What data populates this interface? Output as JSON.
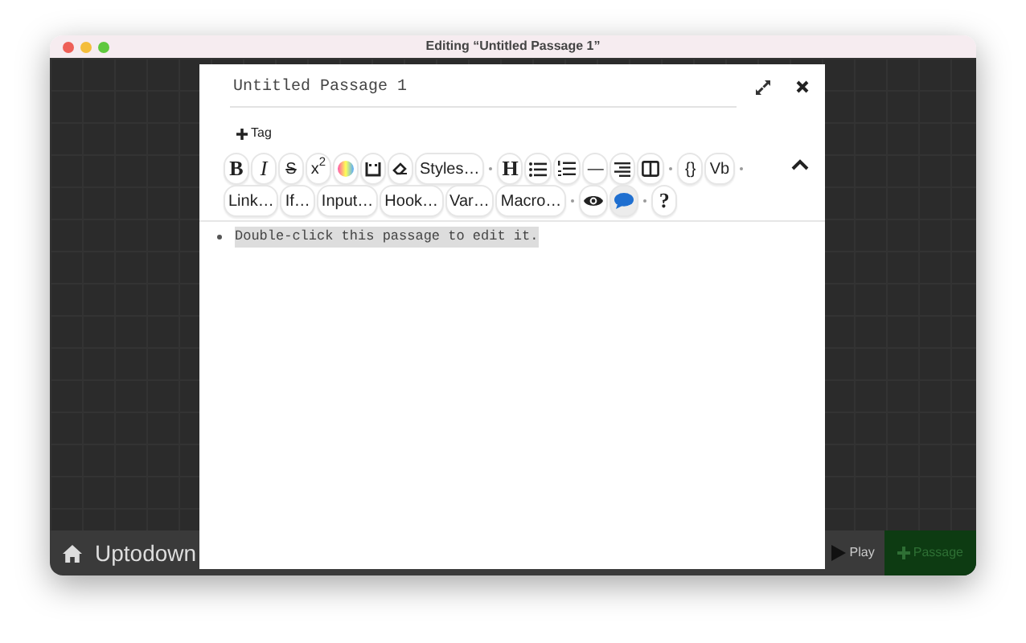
{
  "window": {
    "title": "Editing “Untitled Passage 1”"
  },
  "story_bar": {
    "story_name": "Uptodown",
    "play_label": "Play",
    "new_passage_label": "Passage"
  },
  "dialog": {
    "passage_name": "Untitled Passage 1",
    "tag_button": "Tag",
    "toolbar_rows": [
      [
        {
          "kind": "text",
          "label": "B"
        },
        {
          "kind": "text",
          "label": "I"
        },
        {
          "kind": "text",
          "label": "S"
        },
        {
          "kind": "text",
          "label": "x$^{2}$"
        },
        {
          "kind": "icon"
        },
        {
          "kind": "icon"
        },
        {
          "kind": "icon"
        },
        {
          "kind": "text",
          "label": "Styles…"
        },
        {
          "kind": "sep"
        },
        {
          "kind": "text",
          "label": "H"
        },
        {
          "kind": "icon"
        },
        {
          "kind": "icon"
        },
        {
          "kind": "text",
          "label": "—"
        },
        {
          "kind": "icon"
        },
        {
          "kind": "icon"
        },
        {
          "kind": "sep"
        },
        {
          "kind": "text",
          "label": "{}"
        },
        {
          "kind": "text",
          "label": "Vb"
        },
        {
          "kind": "sep"
        }
      ],
      [
        {
          "kind": "text",
          "label": "Link…"
        },
        {
          "kind": "text",
          "label": "If…"
        },
        {
          "kind": "text",
          "label": "Input…"
        },
        {
          "kind": "text",
          "label": "Hook…"
        },
        {
          "kind": "text",
          "label": "Var…"
        },
        {
          "kind": "text",
          "label": "Macro…"
        },
        {
          "kind": "sep"
        },
        {
          "kind": "icon",
          "selected": false
        },
        {
          "kind": "icon",
          "selected": true
        },
        {
          "kind": "sep"
        },
        {
          "kind": "text",
          "label": "?"
        }
      ]
    ],
    "body_text": "Double-click this passage to edit it."
  }
}
